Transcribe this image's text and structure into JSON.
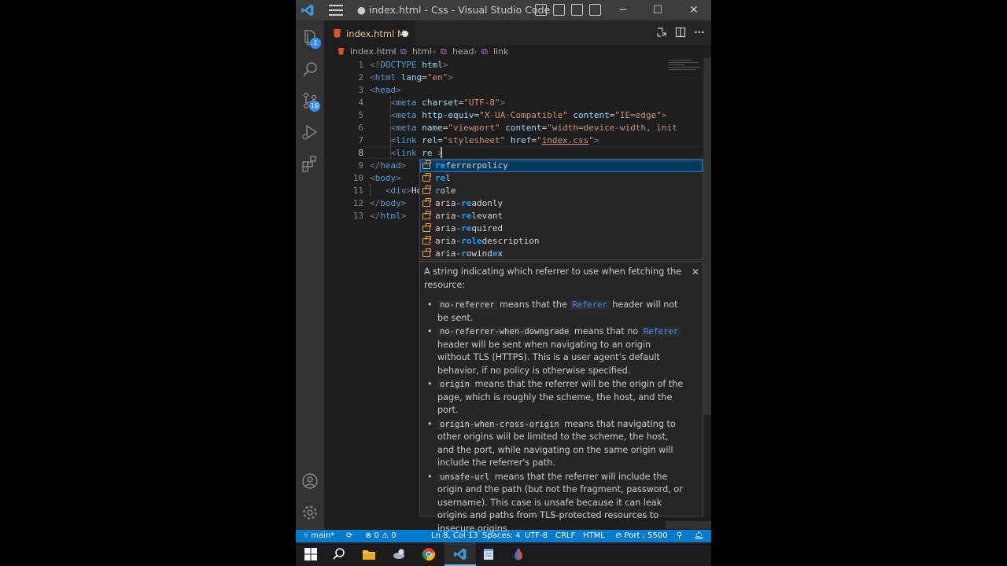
{
  "titlebar": {
    "title": "● index.html - Css - Visual Studio Code",
    "minimize": "─",
    "maximize": "☐",
    "close": "✕"
  },
  "activity": {
    "explorer_badge": "1",
    "scm_badge": "16"
  },
  "tab": {
    "filename": "index.html",
    "modified": "M"
  },
  "breadcrumb": [
    "index.html",
    "html",
    "head",
    "link"
  ],
  "editor": {
    "line_numbers": [
      "1",
      "2",
      "3",
      "4",
      "5",
      "6",
      "7",
      "8",
      "9",
      "10",
      "11",
      "12",
      "13"
    ],
    "active_line": "8"
  },
  "suggestions": {
    "items": [
      {
        "typed": "re",
        "rest": "ferrerpolicy"
      },
      {
        "typed": "re",
        "rest": "l"
      },
      {
        "typed": "r",
        "rest": "ole"
      },
      {
        "prefix": "aria-",
        "typed": "re",
        "rest": "adonly"
      },
      {
        "prefix": "aria-",
        "typed": "re",
        "rest": "levant"
      },
      {
        "prefix": "aria-",
        "typed": "re",
        "rest": "quired"
      },
      {
        "prefix": "aria-",
        "typed": "role",
        "rest": "description"
      },
      {
        "prefix": "aria-",
        "typed": "r",
        "rest": "owind",
        "typed2": "e",
        "rest2": "x"
      }
    ]
  },
  "details": {
    "close": "✕",
    "intro": "A string indicating which referrer to use when fetching the resource:",
    "bullets": [
      {
        "code": "no-referrer",
        "pre": " means that the ",
        "ref": "Referer",
        "post": " header will not be sent."
      },
      {
        "code": "no-referrer-when-downgrade",
        "pre": " means that no ",
        "ref": "Referer",
        "post": " header will be sent when navigating to an origin without TLS (HTTPS). This is a user agent’s default behavior, if no policy is otherwise specified."
      },
      {
        "code": "origin",
        "text": " means that the referrer will be the origin of the page, which is roughly the scheme, the host, and the port."
      },
      {
        "code": "origin-when-cross-origin",
        "text": " means that navigating to other origins will be limited to the scheme, the host, and the port, while navigating on the same origin will include the referrer's path."
      },
      {
        "code": "unsafe-url",
        "text": " means that the referrer will include the origin and the path (but not the fragment, password, or username). This case is unsafe because it can leak origins and paths from TLS-protected resources to insecure origins."
      }
    ]
  },
  "statusbar": {
    "branch": "main*",
    "problems": "⊗ 0 ⚠ 0",
    "position": "Ln 8, Col 13",
    "spaces": "Spaces: 4",
    "encoding": "UTF-8",
    "eol": "CRLF",
    "language": "HTML",
    "port": "Port : 5500"
  },
  "colors": {
    "accent": "#007acc",
    "suggest_highlight": "#18a3ff"
  }
}
